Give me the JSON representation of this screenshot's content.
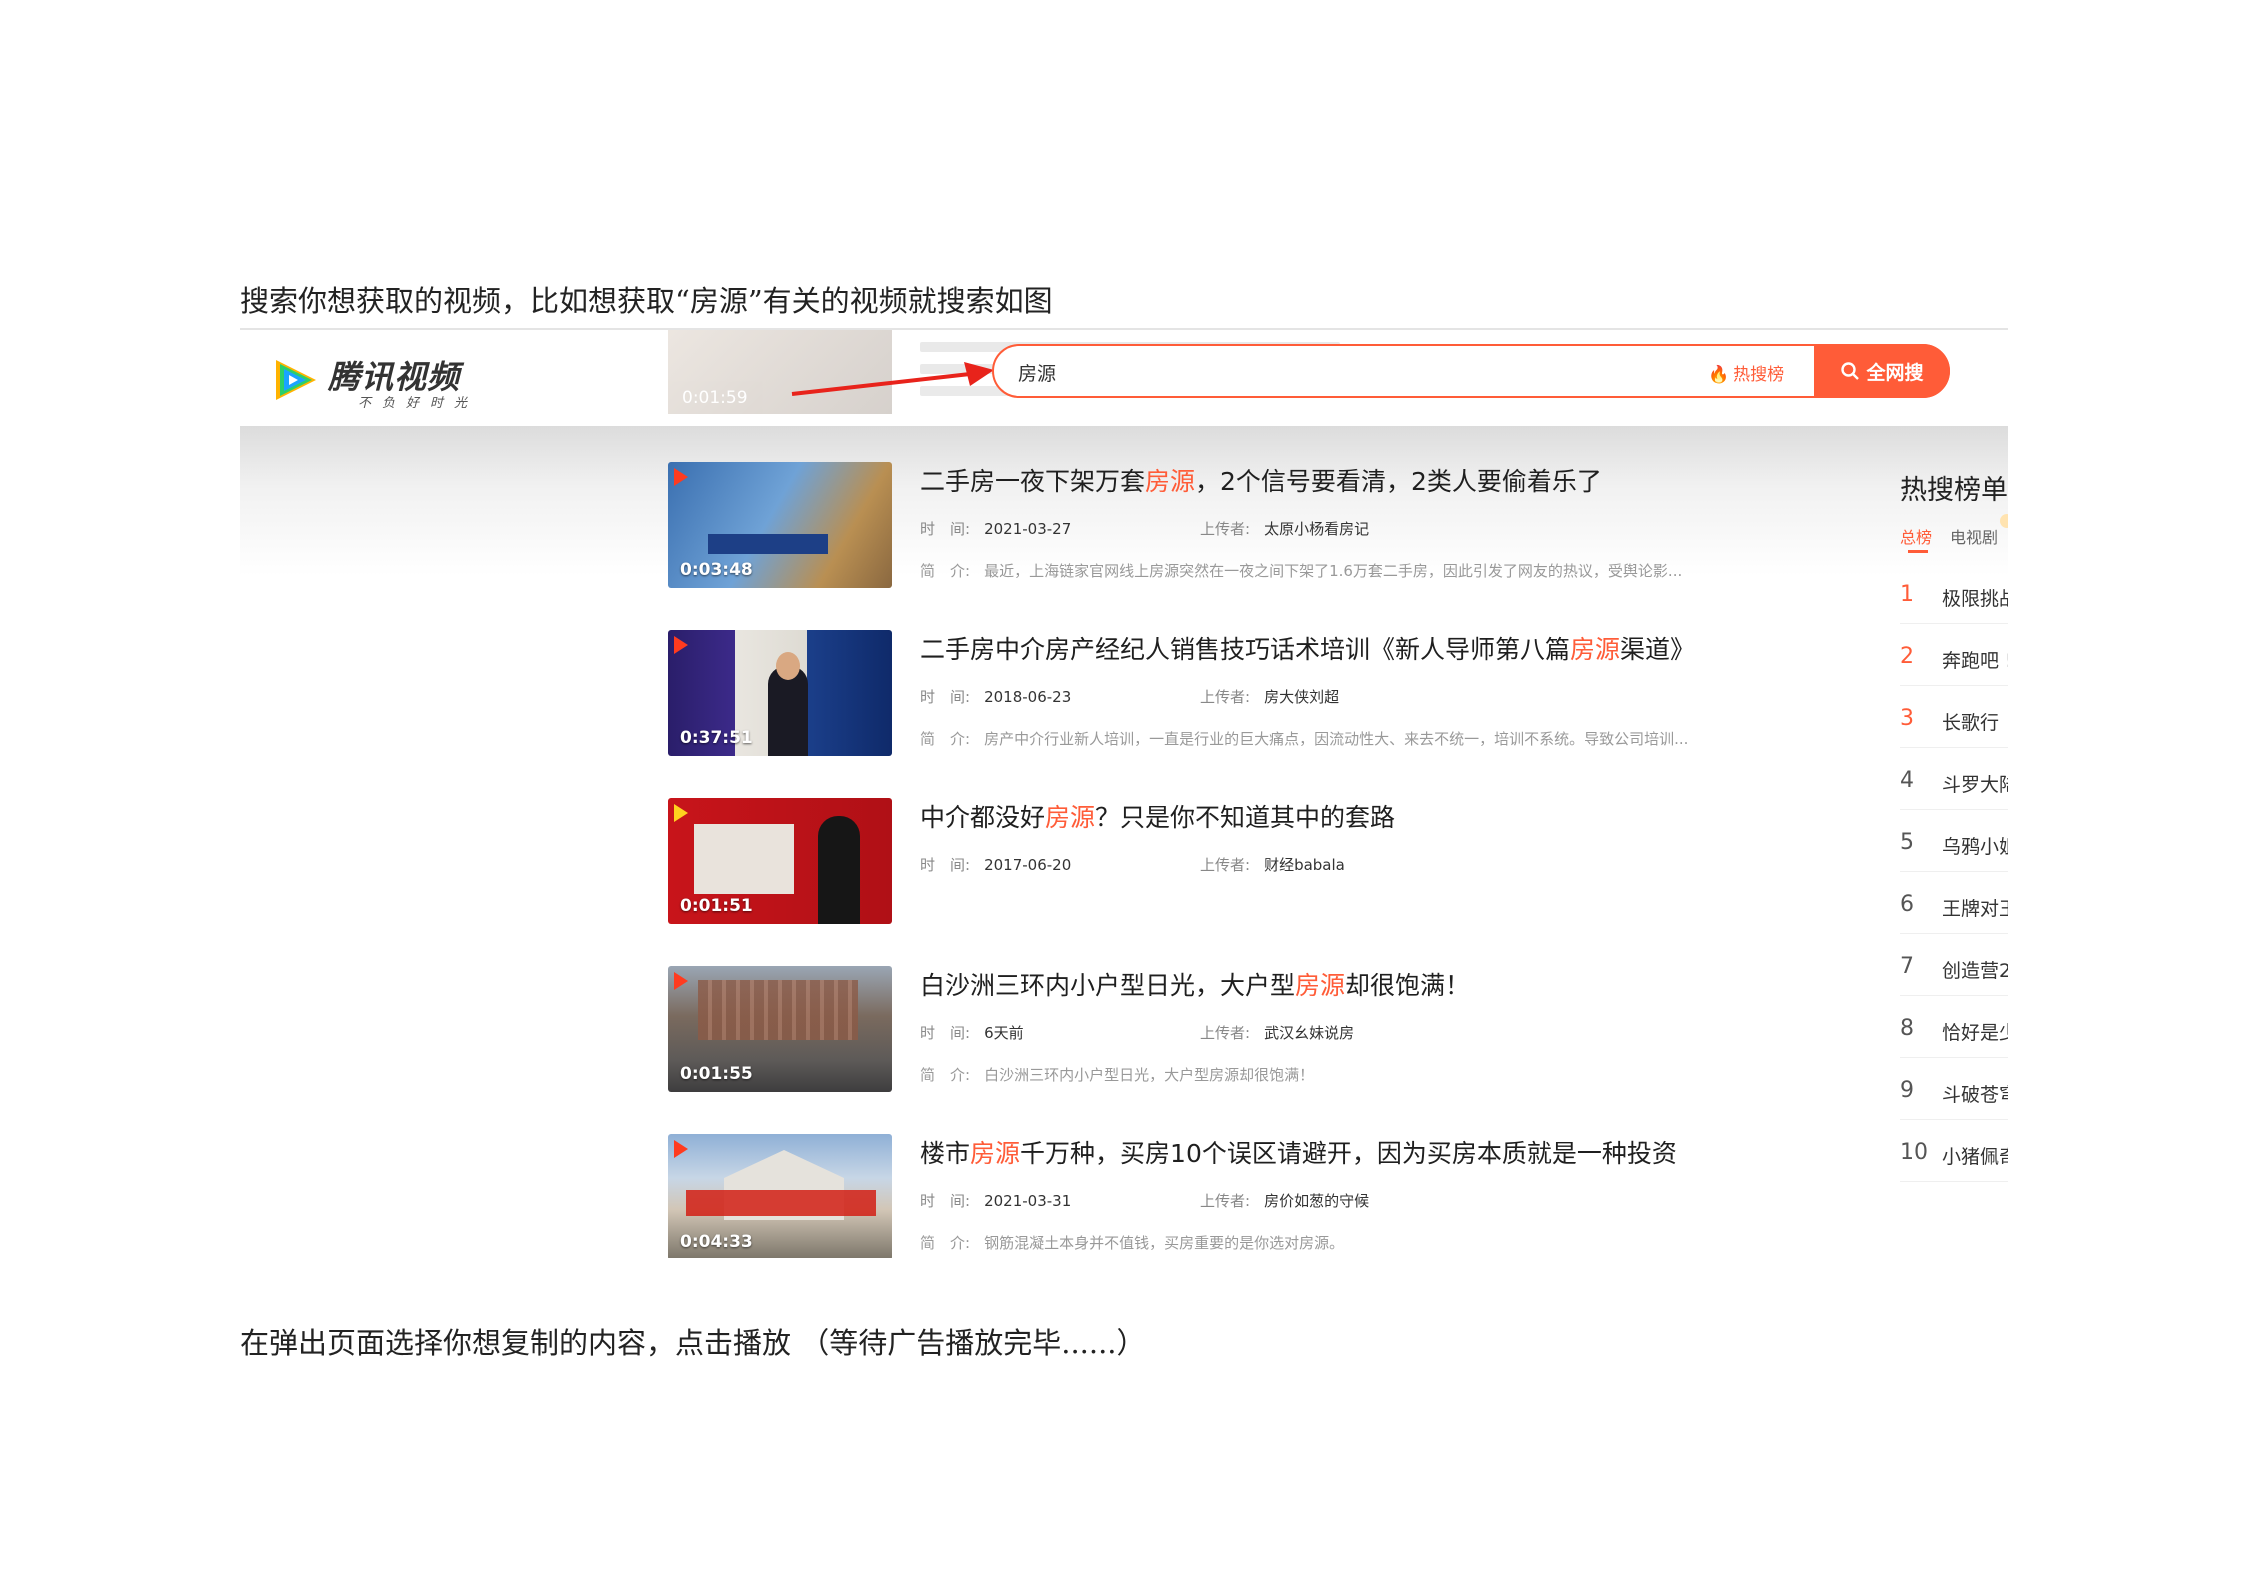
{
  "document": {
    "intro": "搜索你想获取的视频，比如想获取“房源”有关的视频就搜索如图",
    "outro": "在弹出页面选择你想复制的内容，点击播放 （等待广告播放完毕......）"
  },
  "header": {
    "brand": "腾讯视频",
    "slogan": "不负好时光",
    "bg_thumb_duration": "0:01:59"
  },
  "search": {
    "value": "房源",
    "hot_link": "热搜榜",
    "button": "全网搜"
  },
  "colors": {
    "accent": "#ff5c38",
    "brand_blue": "#1aa3ff",
    "brand_green": "#2ccf6a",
    "brand_orange": "#ffb300"
  },
  "results": [
    {
      "title_before": "二手房一夜下架万套",
      "title_highlight": "房源",
      "title_after": "，2个信号要看清，2类人要偷着乐了",
      "time_label": "时　间:",
      "time": "2021-03-27",
      "uploader_label": "上传者:",
      "uploader": "太原小杨看房记",
      "desc_label": "简　介:",
      "desc": "最近，上海链家官网线上房源突然在一夜之间下架了1.6万套二手房，因此引发了网友的热议，受舆论影...",
      "duration": "0:03:48"
    },
    {
      "title_before": "二手房中介房产经纪人销售技巧话术培训《新人导师第八篇",
      "title_highlight": "房源",
      "title_after": "渠道》",
      "time_label": "时　间:",
      "time": "2018-06-23",
      "uploader_label": "上传者:",
      "uploader": "房大侠刘超",
      "desc_label": "简　介:",
      "desc": "房产中介行业新人培训，一直是行业的巨大痛点，因流动性大、来去不统一，培训不系统。导致公司培训...",
      "duration": "0:37:51"
    },
    {
      "title_before": "中介都没好",
      "title_highlight": "房源",
      "title_after": "？只是你不知道其中的套路",
      "time_label": "时　间:",
      "time": "2017-06-20",
      "uploader_label": "上传者:",
      "uploader": "财经babala",
      "desc_label": "",
      "desc": "",
      "duration": "0:01:51"
    },
    {
      "title_before": "白沙洲三环内小户型日光，大户型",
      "title_highlight": "房源",
      "title_after": "却很饱满！",
      "time_label": "时　间:",
      "time": "6天前",
      "uploader_label": "上传者:",
      "uploader": "武汉幺妹说房",
      "desc_label": "简　介:",
      "desc": "白沙洲三环内小户型日光，大户型房源却很饱满！",
      "duration": "0:01:55"
    },
    {
      "title_before": "楼市",
      "title_highlight": "房源",
      "title_after": "千万种，买房10个误区请避开，因为买房本质就是一种投资",
      "time_label": "时　间:",
      "time": "2021-03-31",
      "uploader_label": "上传者:",
      "uploader": "房价如葱的守候",
      "desc_label": "简　介:",
      "desc": "钢筋混凝土本身并不值钱，买房重要的是你选对房源。",
      "duration": "0:04:33"
    }
  ],
  "hot_list": {
    "title": "热搜榜单",
    "tab_active": "总榜",
    "tab_other": "电视剧",
    "items": [
      {
        "rank": "1",
        "name": "极限挑战"
      },
      {
        "rank": "2",
        "name": "奔跑吧 !"
      },
      {
        "rank": "3",
        "name": "长歌行"
      },
      {
        "rank": "4",
        "name": "斗罗大陆"
      },
      {
        "rank": "5",
        "name": "乌鸦小姐"
      },
      {
        "rank": "6",
        "name": "王牌对王"
      },
      {
        "rank": "7",
        "name": "创造营2"
      },
      {
        "rank": "8",
        "name": "恰好是少"
      },
      {
        "rank": "9",
        "name": "斗破苍穹"
      },
      {
        "rank": "10",
        "name": "小猪佩奇"
      }
    ]
  }
}
